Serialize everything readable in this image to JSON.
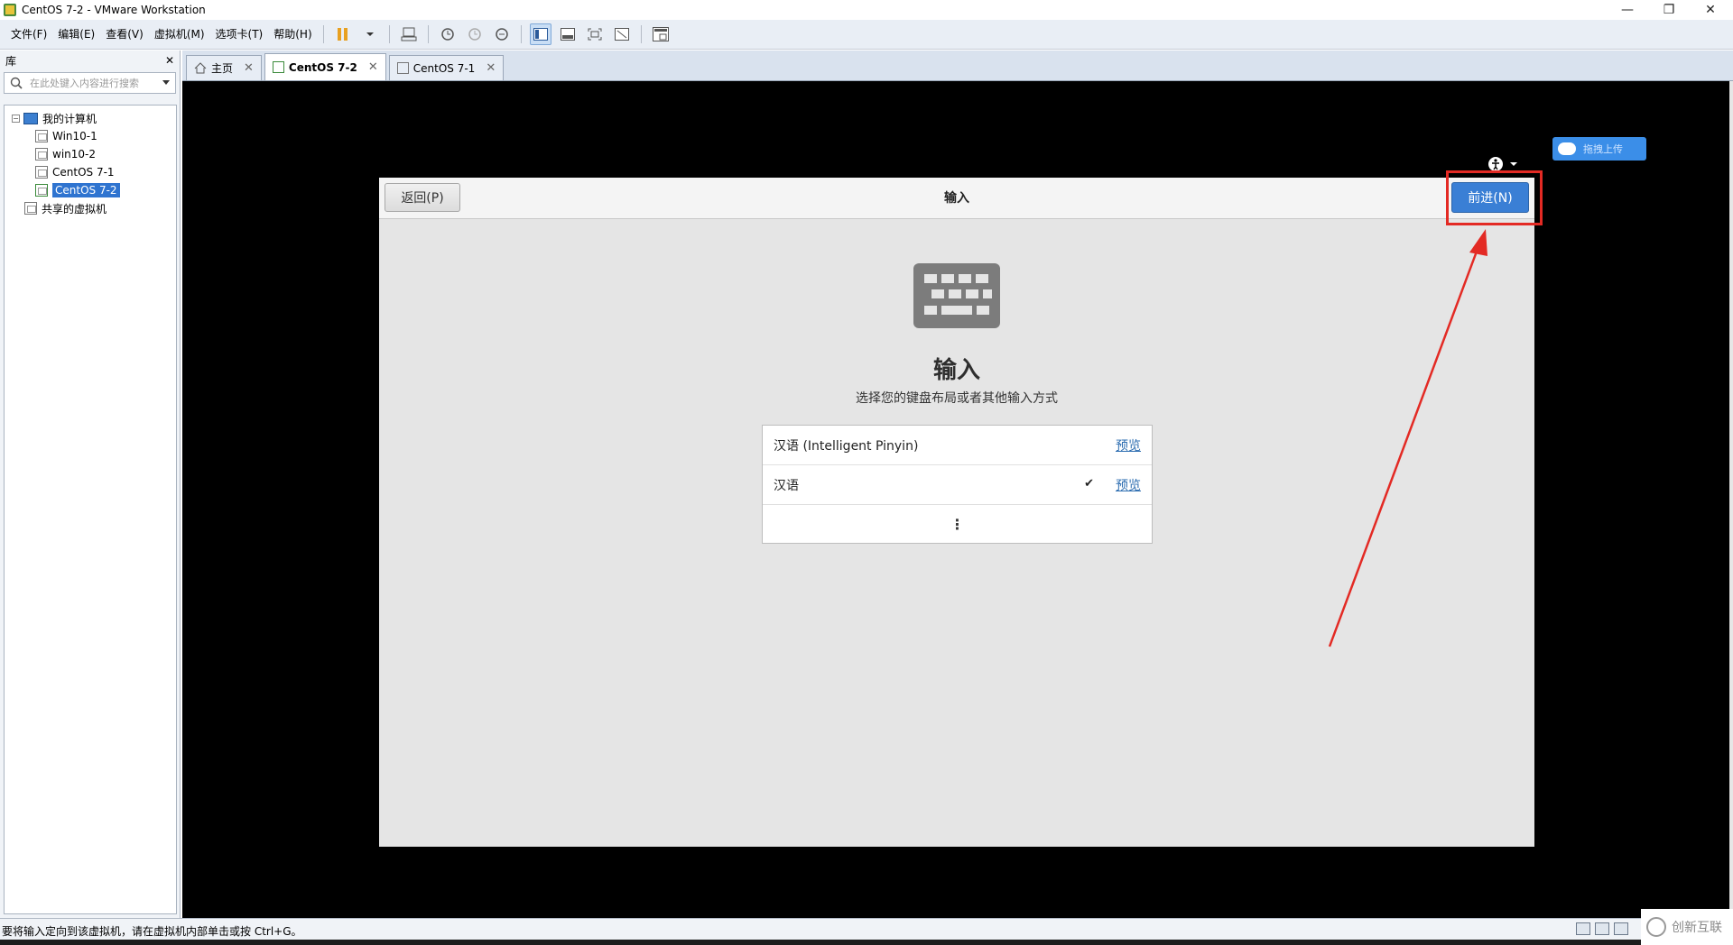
{
  "window": {
    "title": "CentOS 7-2 - VMware Workstation",
    "controls": [
      "—",
      "❐",
      "✕"
    ]
  },
  "menu": [
    "文件(F)",
    "编辑(E)",
    "查看(V)",
    "虚拟机(M)",
    "选项卡(T)",
    "帮助(H)"
  ],
  "library": {
    "title": "库",
    "close": "✕",
    "search_placeholder": "在此处键入内容进行搜索",
    "tree": {
      "root": "我的计算机",
      "vms": [
        "Win10-1",
        "win10-2",
        "CentOS 7-1",
        "CentOS 7-2"
      ],
      "selected": "CentOS 7-2",
      "shared": "共享的虚拟机"
    }
  },
  "tabs": [
    {
      "label": "主页",
      "active": false
    },
    {
      "label": "CentOS 7-2",
      "active": true
    },
    {
      "label": "CentOS 7-1",
      "active": false
    }
  ],
  "overlay": {
    "upload_label": "拖拽上传"
  },
  "installer": {
    "back_label": "返回(P)",
    "header_title": "输入",
    "next_label": "前进(N)",
    "heading": "输入",
    "subheading": "选择您的键盘布局或者其他输入方式",
    "layouts": [
      {
        "name": "汉语 (Intelligent Pinyin)",
        "checked": false,
        "preview": "预览"
      },
      {
        "name": "汉语",
        "checked": true,
        "check_mark": "✔",
        "preview": "预览"
      }
    ],
    "more_glyph": "⋮"
  },
  "status": {
    "message": "要将输入定向到该虚拟机，请在虚拟机内部单击或按 Ctrl+G。"
  },
  "watermark": {
    "text": "创新互联"
  },
  "colors": {
    "next_button": "#3a7fd5",
    "highlight": "#e32a24",
    "selected_tree": "#2f74d0"
  }
}
